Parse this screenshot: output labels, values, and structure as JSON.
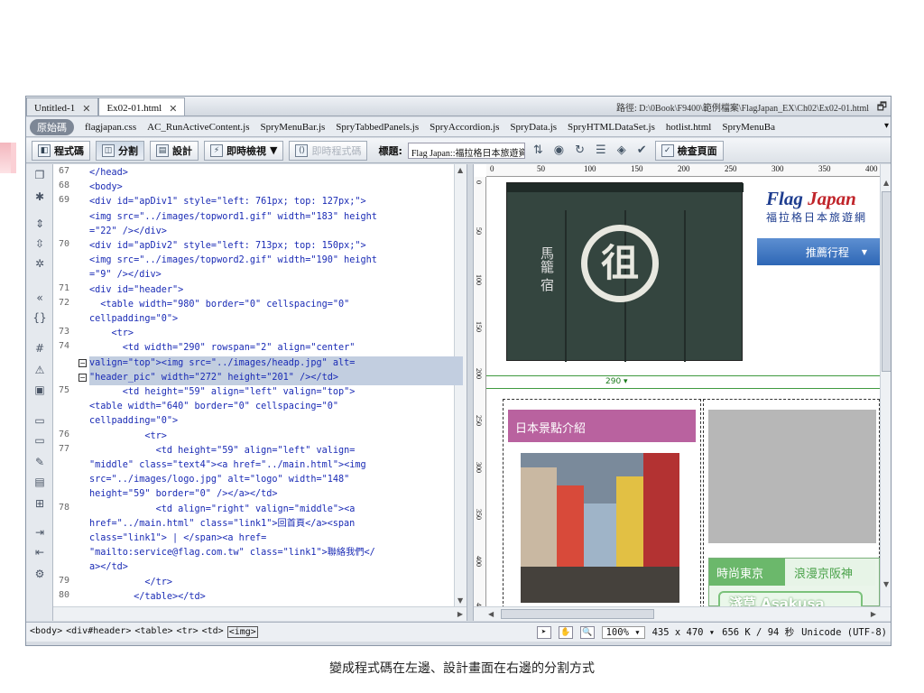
{
  "tabs": [
    {
      "label": "Untitled-1",
      "active": false
    },
    {
      "label": "Ex02-01.html",
      "active": true
    }
  ],
  "path_text": "路徑: D:\\0Book\\F9400\\範例檔案\\FlagJapan_EX\\Ch02\\Ex02-01.html",
  "related_files": {
    "source_label": "原始碼",
    "items": [
      "flagjapan.css",
      "AC_RunActiveContent.js",
      "SpryMenuBar.js",
      "SpryTabbedPanels.js",
      "SpryAccordion.js",
      "SpryData.js",
      "SpryHTMLDataSet.js",
      "hotlist.html",
      "SpryMenuBa"
    ]
  },
  "toolbar": {
    "code_label": "程式碼",
    "split_label": "分割",
    "design_label": "設計",
    "live_view_label": "即時檢視",
    "live_code_label": "即時程式碼",
    "title_label": "標題:",
    "title_value": "Flag Japan::福拉格日本旅遊資",
    "check_page_label": "檢查頁面"
  },
  "code_lines": [
    {
      "num": "67",
      "text": "</head>"
    },
    {
      "num": "68",
      "text": "<body>"
    },
    {
      "num": "69",
      "text": "<div id=\"apDiv1\" style=\"left: 761px; top: 127px;\">"
    },
    {
      "num": "",
      "text": "<img src=\"../images/topword1.gif\" width=\"183\" height"
    },
    {
      "num": "",
      "text": "=\"22\" /></div>"
    },
    {
      "num": "70",
      "text": "<div id=\"apDiv2\" style=\"left: 713px; top: 150px;\">"
    },
    {
      "num": "",
      "text": "<img src=\"../images/topword2.gif\" width=\"190\" height"
    },
    {
      "num": "",
      "text": "=\"9\" /></div>"
    },
    {
      "num": "71",
      "text": "<div id=\"header\">"
    },
    {
      "num": "72",
      "text": "  <table width=\"980\" border=\"0\" cellspacing=\"0\""
    },
    {
      "num": "",
      "text": "cellpadding=\"0\">"
    },
    {
      "num": "73",
      "text": "    <tr>"
    },
    {
      "num": "74",
      "text": "      <td width=\"290\" rowspan=\"2\" align=\"center\""
    },
    {
      "num": "",
      "text": "valign=\"top\"><img src=\"../images/headp.jpg\" alt="
    },
    {
      "num": "",
      "text": "\"header_pic\" width=\"272\" height=\"201\" /></td>"
    },
    {
      "num": "75",
      "text": "      <td height=\"59\" align=\"left\" valign=\"top\">"
    },
    {
      "num": "",
      "text": "<table width=\"640\" border=\"0\" cellspacing=\"0\""
    },
    {
      "num": "",
      "text": "cellpadding=\"0\">"
    },
    {
      "num": "76",
      "text": "          <tr>"
    },
    {
      "num": "77",
      "text": "            <td height=\"59\" align=\"left\" valign="
    },
    {
      "num": "",
      "text": "\"middle\" class=\"text4\"><a href=\"../main.html\"><img"
    },
    {
      "num": "",
      "text": "src=\"../images/logo.jpg\" alt=\"logo\" width=\"148\""
    },
    {
      "num": "",
      "text": "height=\"59\" border=\"0\" /></a></td>"
    },
    {
      "num": "78",
      "text": "            <td align=\"right\" valign=\"middle\"><a"
    },
    {
      "num": "",
      "text": "href=\"../main.html\" class=\"link1\">回首頁</a><span"
    },
    {
      "num": "",
      "text": "class=\"link1\"> | </span><a href="
    },
    {
      "num": "",
      "text": "\"mailto:service@flag.com.tw\" class=\"link1\">聯絡我們</"
    },
    {
      "num": "",
      "text": "a></td>"
    },
    {
      "num": "79",
      "text": "          </tr>"
    },
    {
      "num": "80",
      "text": "        </table></td>"
    }
  ],
  "ruler": {
    "h_ticks": [
      "0",
      "50",
      "100",
      "150",
      "200",
      "250",
      "300",
      "350",
      "400"
    ],
    "v_ticks": [
      "0",
      "50",
      "100",
      "150",
      "200",
      "250",
      "300",
      "350",
      "400",
      "450"
    ]
  },
  "design": {
    "noren_symbol": "徂",
    "noren_text": "馬籠 宿",
    "site_title_a": "Flag ",
    "site_title_b": "Japan",
    "site_subtitle": "福拉格日本旅遊網",
    "menu_item": "推薦行程",
    "menu_arrow": "▼",
    "width_label": "290",
    "spots_heading": "日本景點介紹",
    "tab_tokyo": "時尚東京",
    "tab_osaka": "浪漫京阪神",
    "asakusa": "淺草 Asakusa"
  },
  "status": {
    "tags": [
      "<body>",
      "<div#header>",
      "<table>",
      "<tr>",
      "<td>",
      "<img>"
    ],
    "zoom": "100%",
    "size": "435 x 470",
    "file_info": "656 K / 94 秒",
    "encoding": "Unicode (UTF-8)"
  },
  "caption": "變成程式碼在左邊、設計畫面在右邊的分割方式"
}
